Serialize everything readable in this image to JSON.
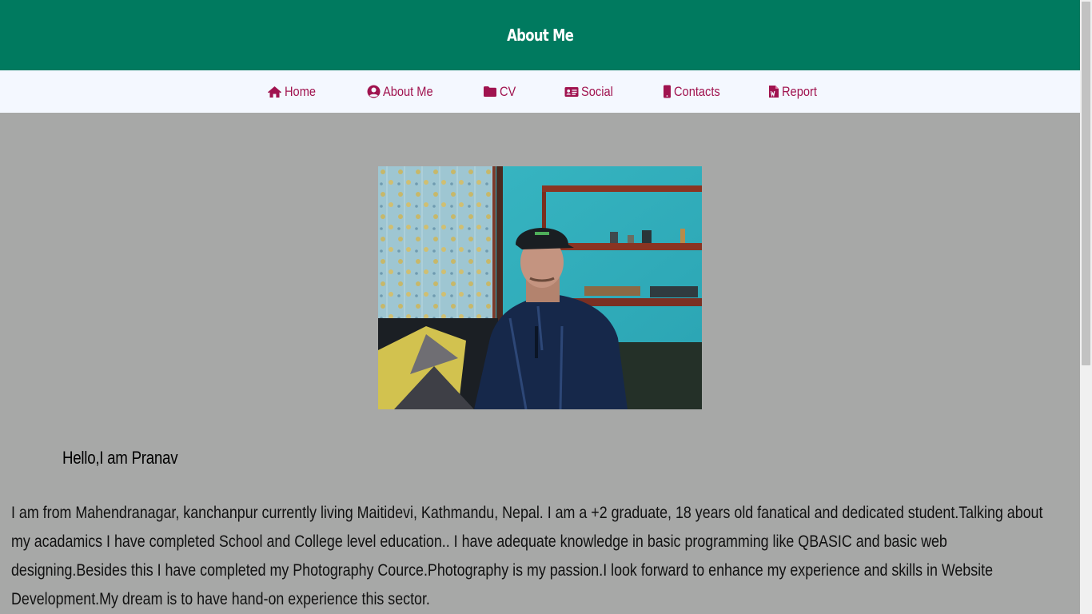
{
  "header": {
    "title": "About Me"
  },
  "nav": {
    "items": [
      {
        "label": "Home",
        "icon": "home-icon"
      },
      {
        "label": "About Me",
        "icon": "user-circle-icon"
      },
      {
        "label": "CV",
        "icon": "folder-icon"
      },
      {
        "label": "Social",
        "icon": "id-card-icon"
      },
      {
        "label": "Contacts",
        "icon": "mobile-phone-icon"
      },
      {
        "label": "Report",
        "icon": "word-document-icon"
      }
    ]
  },
  "main": {
    "greeting": "Hello,I am Pranav",
    "bio": "I am from Mahendranagar, kanchanpur currently living Maitidevi, Kathmandu, Nepal. I am a +2 graduate, 18 years old fanatical and dedicated student.Talking about my acadamics I have completed School and College level education.. I have adequate knowledge in basic programming like QBASIC and basic web designing.Besides this I have completed my Photography Cource.Photography is my passion.I look forward to enhance my experience and skills in Website Development.My dream is to have hand-on experience this sector."
  },
  "colors": {
    "header_bg": "#007a5f",
    "nav_bg": "#f4f8ff",
    "nav_text": "#a0134f",
    "page_bg": "#a7a8a7"
  }
}
